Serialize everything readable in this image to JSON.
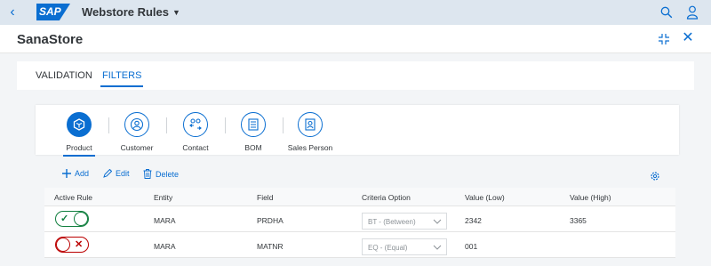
{
  "shell": {
    "logo": "SAP",
    "title": "Webstore Rules"
  },
  "header": {
    "title": "SanaStore"
  },
  "tabs": [
    {
      "label": "VALIDATION",
      "selected": false
    },
    {
      "label": "FILTERS",
      "selected": true
    }
  ],
  "icon_tabs": [
    {
      "label": "Product",
      "icon": "product-icon",
      "selected": true
    },
    {
      "label": "Customer",
      "icon": "customer-icon",
      "selected": false
    },
    {
      "label": "Contact",
      "icon": "contact-icon",
      "selected": false
    },
    {
      "label": "BOM",
      "icon": "bom-icon",
      "selected": false
    },
    {
      "label": "Sales Person",
      "icon": "sales-person-icon",
      "selected": false
    }
  ],
  "toolbar": {
    "add_label": "Add",
    "edit_label": "Edit",
    "delete_label": "Delete"
  },
  "table": {
    "columns": [
      "Active Rule",
      "Entity",
      "Field",
      "Criteria Option",
      "Value (Low)",
      "Value (High)"
    ],
    "rows": [
      {
        "active": true,
        "entity": "MARA",
        "field": "PRDHA",
        "criteria": "BT - (Between)",
        "low": "2342",
        "high": "3365"
      },
      {
        "active": false,
        "entity": "MARA",
        "field": "MATNR",
        "criteria": "EQ - (Equal)",
        "low": "001",
        "high": ""
      }
    ]
  },
  "colors": {
    "accent": "#0a6ed1",
    "positive": "#107e3e",
    "negative": "#bb0000",
    "shell_bg": "#dde6ef"
  }
}
